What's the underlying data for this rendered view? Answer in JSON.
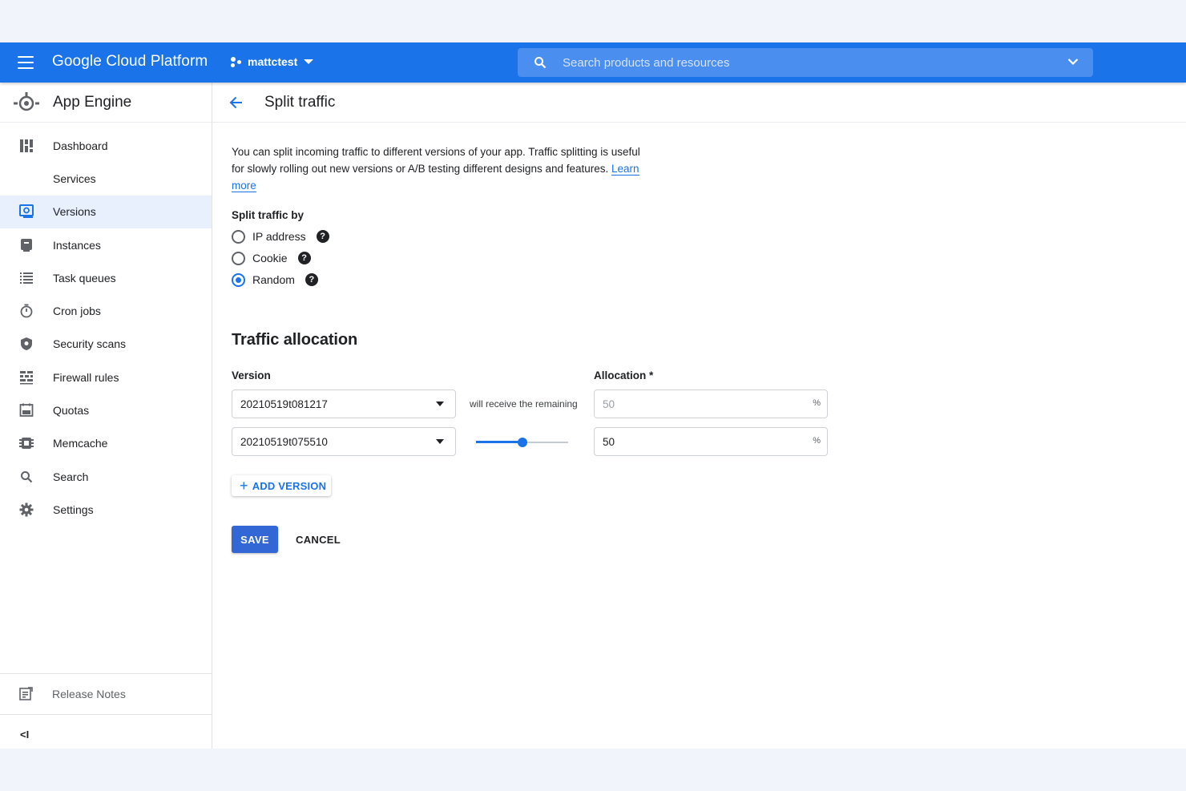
{
  "topbar": {
    "brand": "Google Cloud Platform",
    "project": "mattctest",
    "search_placeholder": "Search products and resources"
  },
  "sidebar": {
    "title": "App Engine",
    "items": [
      {
        "label": "Dashboard",
        "icon": "dashboard-icon"
      },
      {
        "label": "Services",
        "icon": "services-icon"
      },
      {
        "label": "Versions",
        "icon": "versions-icon",
        "active": true
      },
      {
        "label": "Instances",
        "icon": "instances-icon"
      },
      {
        "label": "Task queues",
        "icon": "list-icon"
      },
      {
        "label": "Cron jobs",
        "icon": "timer-icon"
      },
      {
        "label": "Security scans",
        "icon": "shield-icon"
      },
      {
        "label": "Firewall rules",
        "icon": "firewall-icon"
      },
      {
        "label": "Quotas",
        "icon": "quotas-icon"
      },
      {
        "label": "Memcache",
        "icon": "memcache-icon"
      },
      {
        "label": "Search",
        "icon": "search-icon"
      },
      {
        "label": "Settings",
        "icon": "gear-icon"
      }
    ],
    "release_notes": "Release Notes",
    "collapse": "<I"
  },
  "main": {
    "title": "Split traffic",
    "description": "You can split incoming traffic to different versions of your app. Traffic splitting is useful for slowly rolling out new versions or A/B testing different designs and features. ",
    "learn_more": "Learn more",
    "split_by_label": "Split traffic by",
    "split_options": [
      {
        "label": "IP address",
        "selected": false
      },
      {
        "label": "Cookie",
        "selected": false
      },
      {
        "label": "Random",
        "selected": true
      }
    ],
    "allocation_title": "Traffic allocation",
    "version_label": "Version",
    "allocation_label": "Allocation *",
    "rows": [
      {
        "version": "20210519t081217",
        "middle": "will receive the remaining",
        "allocation": "50",
        "unit": "%"
      },
      {
        "version": "20210519t075510",
        "allocation": "50",
        "unit": "%",
        "slider_percent": 50
      }
    ],
    "add_version": "ADD VERSION",
    "save": "SAVE",
    "cancel": "CANCEL"
  },
  "colors": {
    "primary": "#1a73e8",
    "save_button": "#3367d6",
    "active_nav": "#e8f0fe"
  }
}
